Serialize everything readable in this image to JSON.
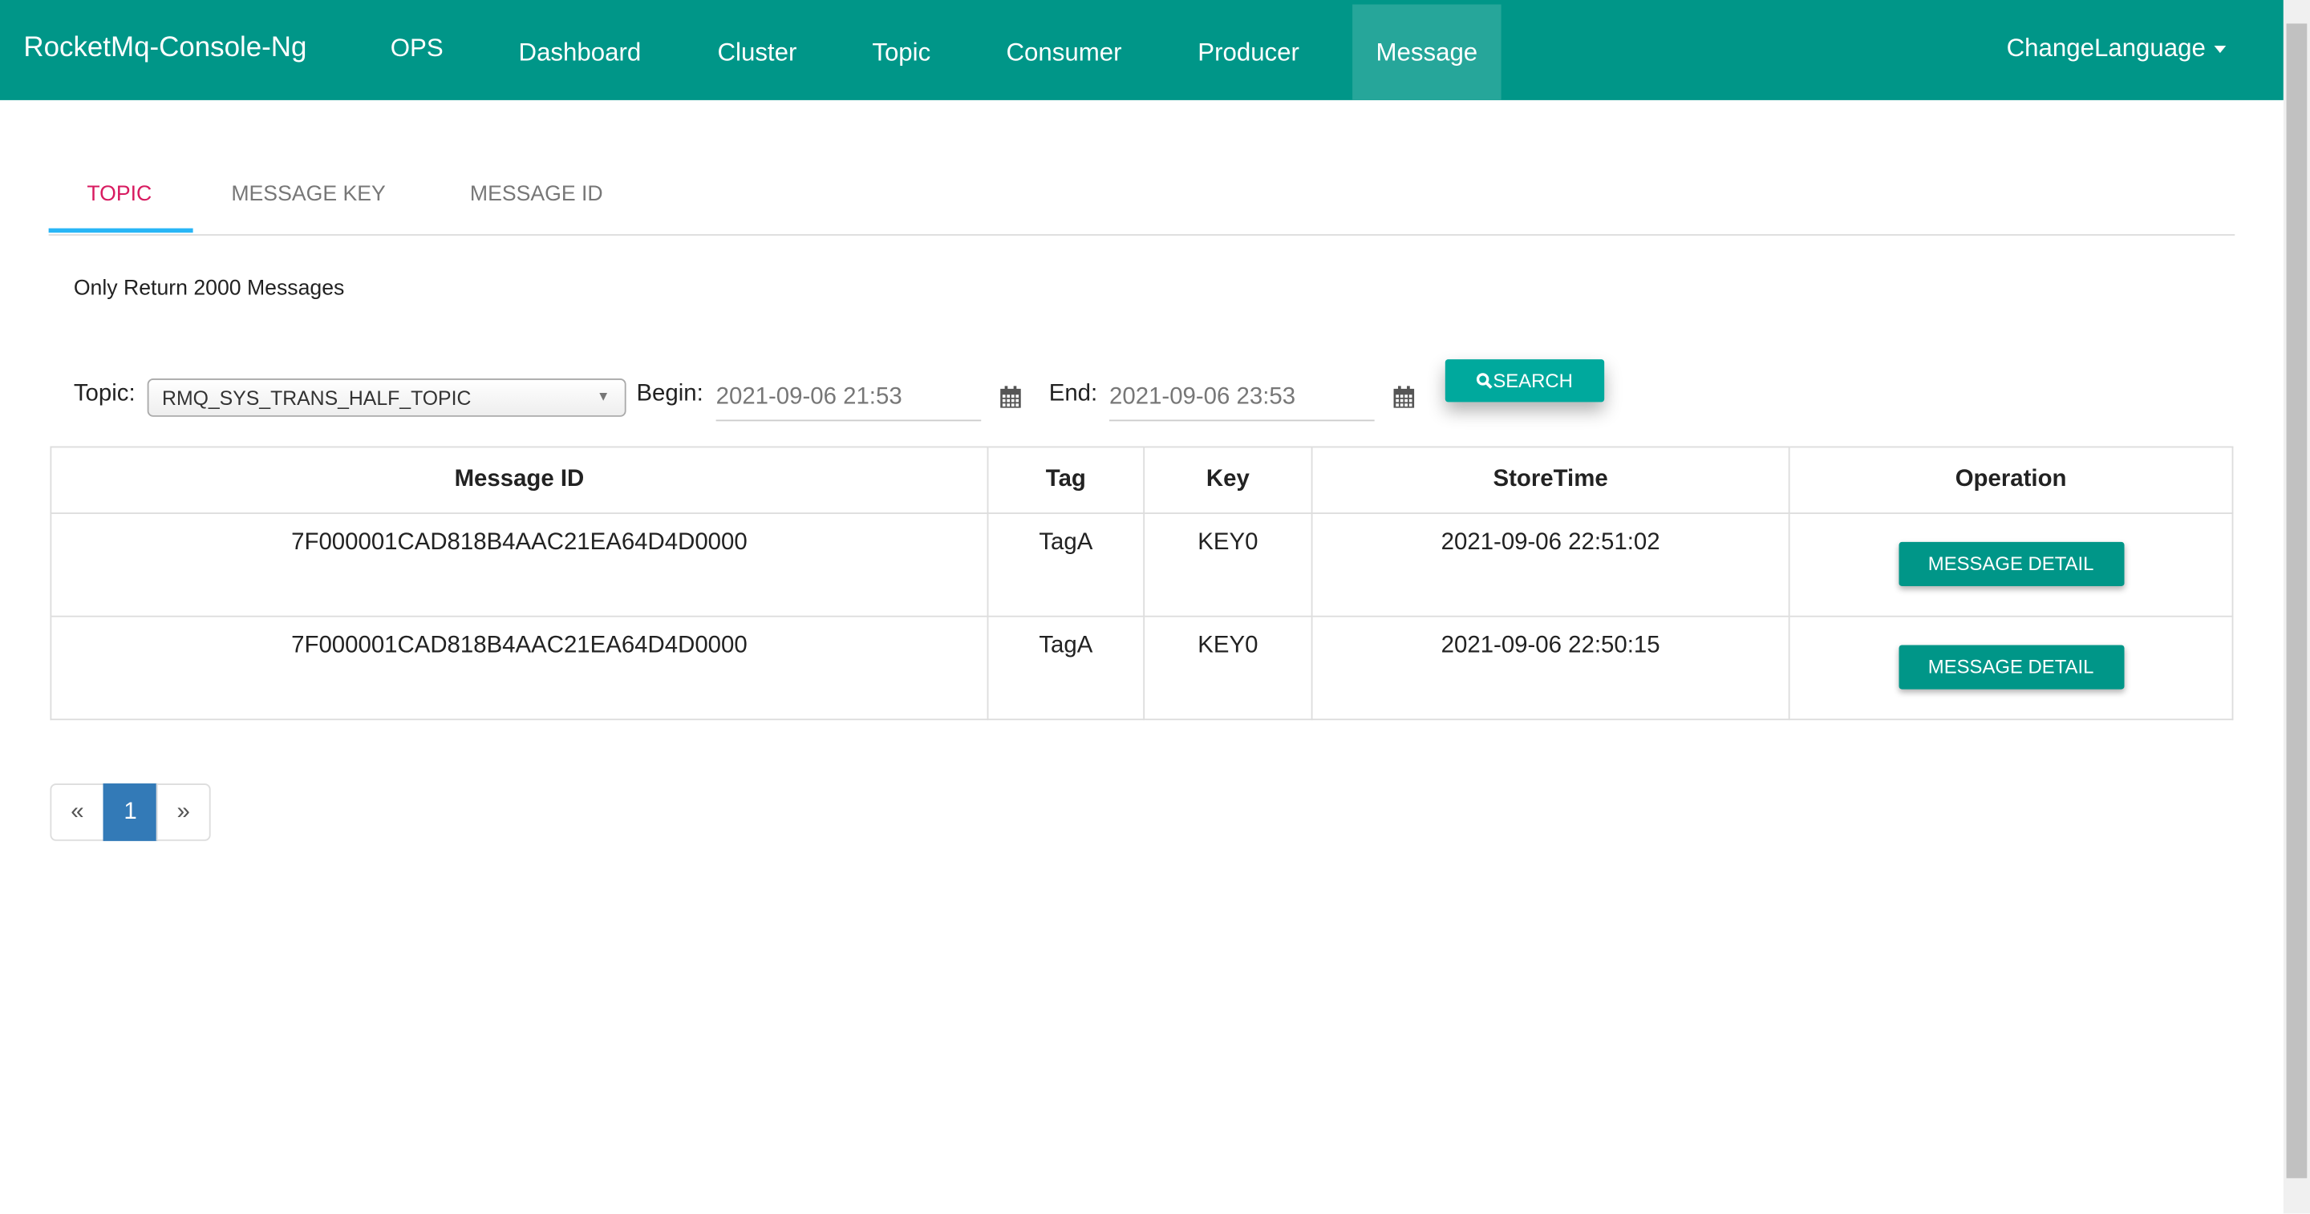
{
  "navbar": {
    "brand": "RocketMq-Console-Ng",
    "items": [
      "OPS",
      "Dashboard",
      "Cluster",
      "Topic",
      "Consumer",
      "Producer",
      "Message"
    ],
    "active": "Message",
    "language": "ChangeLanguage",
    "color": "#009688"
  },
  "tabs": [
    {
      "label": "TOPIC",
      "active": true
    },
    {
      "label": "MESSAGE KEY"
    },
    {
      "label": "MESSAGE ID"
    }
  ],
  "note": "Only Return 2000 Messages",
  "form": {
    "topic_label": "Topic:",
    "topic_value": "RMQ_SYS_TRANS_HALF_TOPIC",
    "begin_label": "Begin:",
    "begin_value": "2021-09-06 21:53",
    "end_label": "End:",
    "end_value": "2021-09-06 23:53",
    "search_label": "SEARCH",
    "search_icon": "search-icon",
    "calendar_icon": "calendar-icon"
  },
  "table": {
    "headers": [
      "Message ID",
      "Tag",
      "Key",
      "StoreTime",
      "Operation"
    ],
    "rows": [
      {
        "id": "7F000001CAD818B4AAC21EA64D4D0000",
        "tag": "TagA",
        "key": "KEY0",
        "time": "2021-09-06 22:51:02",
        "action": "MESSAGE DETAIL"
      },
      {
        "id": "7F000001CAD818B4AAC21EA64D4D0000",
        "tag": "TagA",
        "key": "KEY0",
        "time": "2021-09-06 22:50:15",
        "action": "MESSAGE DETAIL"
      }
    ]
  },
  "pagination": {
    "prev": "«",
    "current": "1",
    "next": "»"
  }
}
